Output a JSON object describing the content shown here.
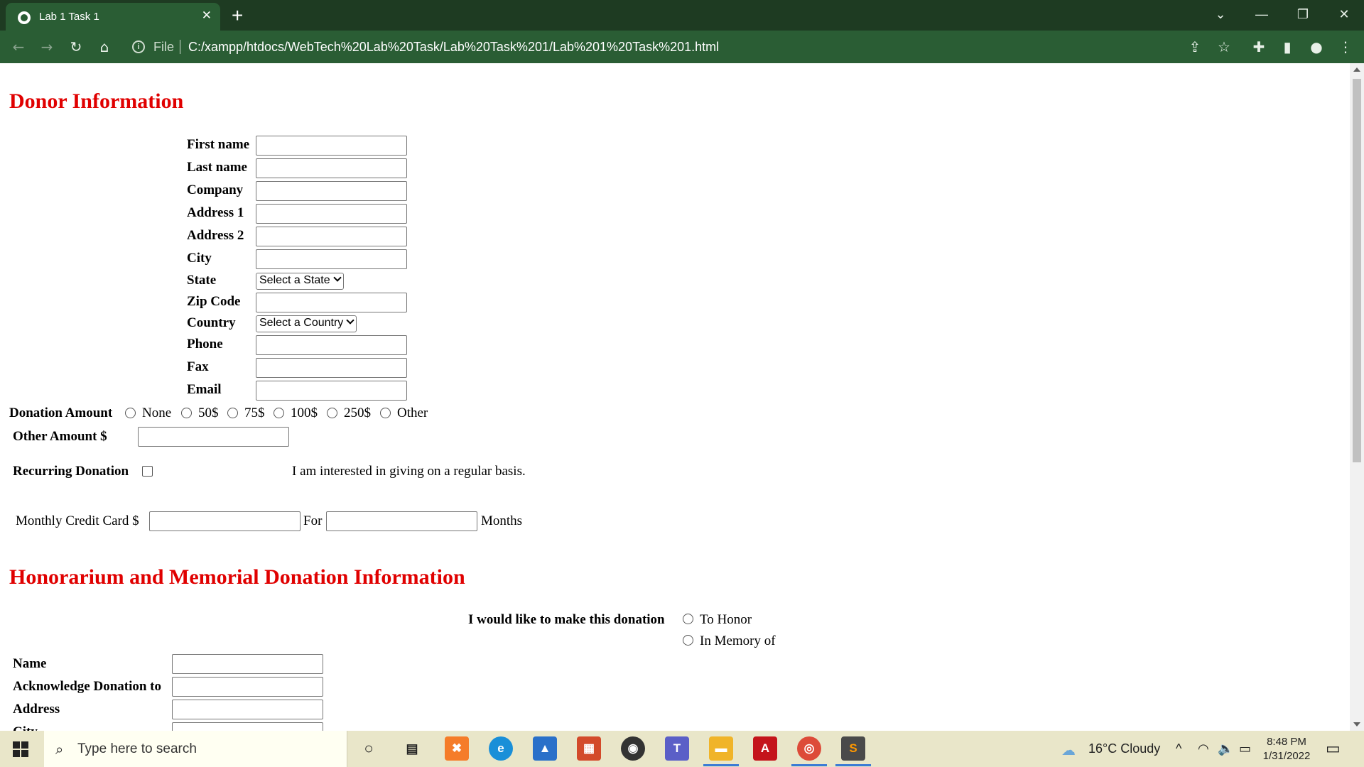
{
  "browser": {
    "tab_title": "Lab 1 Task 1",
    "tab_close": "✕",
    "new_tab": "+",
    "file_label": "File",
    "url": "C:/xampp/htdocs/WebTech%20Lab%20Task/Lab%20Task%201/Lab%201%20Task%201.html"
  },
  "donor": {
    "heading": "Donor Information",
    "fields": {
      "first_name": "First name",
      "last_name": "Last name",
      "company": "Company",
      "address1": "Address 1",
      "address2": "Address 2",
      "city": "City",
      "state": "State",
      "zip": "Zip Code",
      "country": "Country",
      "phone": "Phone",
      "fax": "Fax",
      "email": "Email"
    },
    "state_select": "Select a State",
    "country_select": "Select a Country",
    "donation_amount_label": "Donation Amount",
    "donation_options": [
      "None",
      "50$",
      "75$",
      "100$",
      "250$",
      "Other"
    ],
    "other_amount_label": "Other Amount $",
    "recurring_label": "Recurring Donation",
    "recurring_note": "I am interested in giving on a regular basis.",
    "monthly_label": "Monthly Credit Card $",
    "for_label": "For",
    "months_label": "Months"
  },
  "honorarium": {
    "heading": "Honorarium and Memorial Donation Information",
    "make_donation_label": "I would like to make this donation",
    "option_honor": "To Honor",
    "option_memory": "In Memory of",
    "name_label": "Name",
    "acknowledge_label": "Acknowledge Donation to",
    "address_label": "Address",
    "city_label": "City"
  },
  "taskbar": {
    "search_placeholder": "Type here to search",
    "weather": "16°C  Cloudy",
    "time": "8:48 PM",
    "date": "1/31/2022"
  }
}
